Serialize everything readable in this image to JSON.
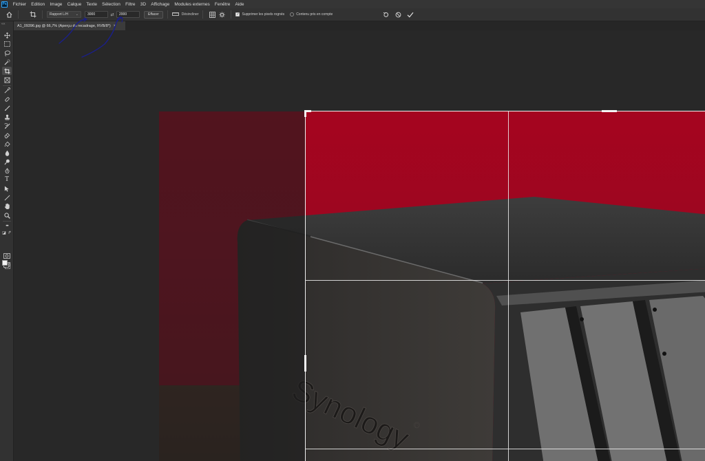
{
  "app": {
    "logo": "Ps"
  },
  "menu": [
    "Fichier",
    "Edition",
    "Image",
    "Calque",
    "Texte",
    "Sélection",
    "Filtre",
    "3D",
    "Affichage",
    "Modules externes",
    "Fenêtre",
    "Aide"
  ],
  "options": {
    "ratio_select": "Rapport L/H",
    "width_value": "3000",
    "height_value": "2000",
    "clear_label": "Effacer",
    "straighten_label": "Désincliner",
    "delete_pixels_label": "Supprimer les pixels rognés",
    "delete_pixels_checked": true,
    "content_aware_label": "Contenu pris en compte",
    "content_aware_checked": false,
    "reset_icon": "undo-icon",
    "cancel_icon": "cancel-icon",
    "commit_icon": "checkmark-icon"
  },
  "document": {
    "tab_title": "A1_09396.jpg @ 66,7% (Aperçu du recadrage, RVB/8*)",
    "tab_close": "×"
  },
  "toolbox": {
    "collapse": "««",
    "tools": [
      "move-tool",
      "marquee-tool",
      "lasso-tool",
      "quick-selection-tool",
      "crop-tool",
      "frame-tool",
      "eyedropper-tool",
      "healing-brush-tool",
      "brush-tool",
      "clone-stamp-tool",
      "history-brush-tool",
      "eraser-tool",
      "gradient-tool",
      "blur-tool",
      "dodge-tool",
      "pen-tool",
      "type-tool",
      "path-selection-tool",
      "line-tool",
      "hand-tool",
      "zoom-tool",
      "more-tools",
      "quick-mask-mode",
      "screen-mode"
    ],
    "type_glyph": "T",
    "more_glyph": "•••"
  },
  "photo": {
    "brand": "Synology",
    "registered": "®"
  },
  "colors": {
    "accent": "#31a8ff",
    "wall": "#a5051f",
    "annotation": "#1a1f8a"
  }
}
